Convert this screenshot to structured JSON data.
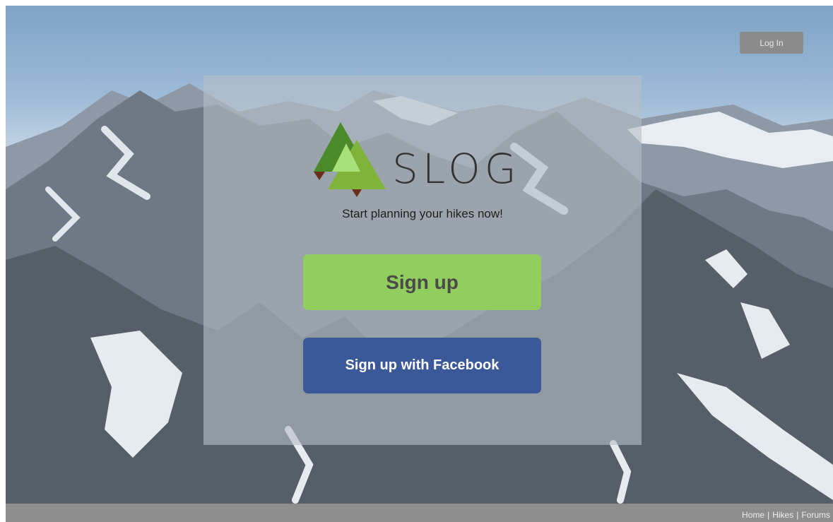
{
  "header": {
    "login_label": "Log In"
  },
  "brand": {
    "name": "SLOG",
    "tagline": "Start planning your hikes now!"
  },
  "actions": {
    "signup_label": "Sign up",
    "facebook_label": "Sign up with Facebook"
  },
  "footer": {
    "links": [
      "Home",
      "Hikes",
      "Forums"
    ],
    "separator": "|"
  },
  "colors": {
    "signup_button": "#92ce5f",
    "facebook_button": "#3b5998",
    "logo_tree_dark": "#4a8a2a",
    "logo_tree_light": "#a8e07a",
    "footer_bar": "#8e8e8e",
    "login_button": "#8b8b8b"
  }
}
